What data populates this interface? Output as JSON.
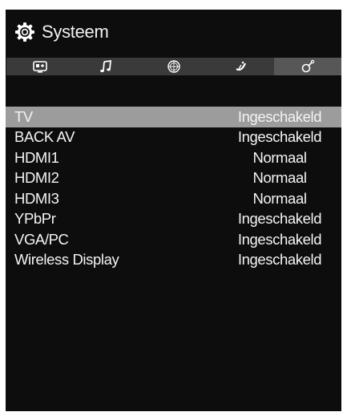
{
  "header": {
    "title": "Systeem",
    "icon": "gear-icon"
  },
  "tabs": [
    {
      "icon": "picture-icon"
    },
    {
      "icon": "music-note-icon"
    },
    {
      "icon": "globe-icon"
    },
    {
      "icon": "satellite-dish-icon"
    },
    {
      "icon": "wrench-settings-icon",
      "active": true
    }
  ],
  "rows": [
    {
      "label": "TV",
      "value": "Ingeschakeld",
      "selected": true
    },
    {
      "label": "BACK AV",
      "value": "Ingeschakeld"
    },
    {
      "label": "HDMI1",
      "value": "Normaal"
    },
    {
      "label": "HDMI2",
      "value": "Normaal"
    },
    {
      "label": "HDMI3",
      "value": "Normaal"
    },
    {
      "label": "YPbPr",
      "value": "Ingeschakeld"
    },
    {
      "label": "VGA/PC",
      "value": "Ingeschakeld"
    },
    {
      "label": "Wireless Display",
      "value": "Ingeschakeld"
    }
  ],
  "colors": {
    "selected_row": "#9c9c9c",
    "active_tab": "#575757",
    "tab_bar": "#3a3a3a",
    "background": "#0d0d0d"
  }
}
